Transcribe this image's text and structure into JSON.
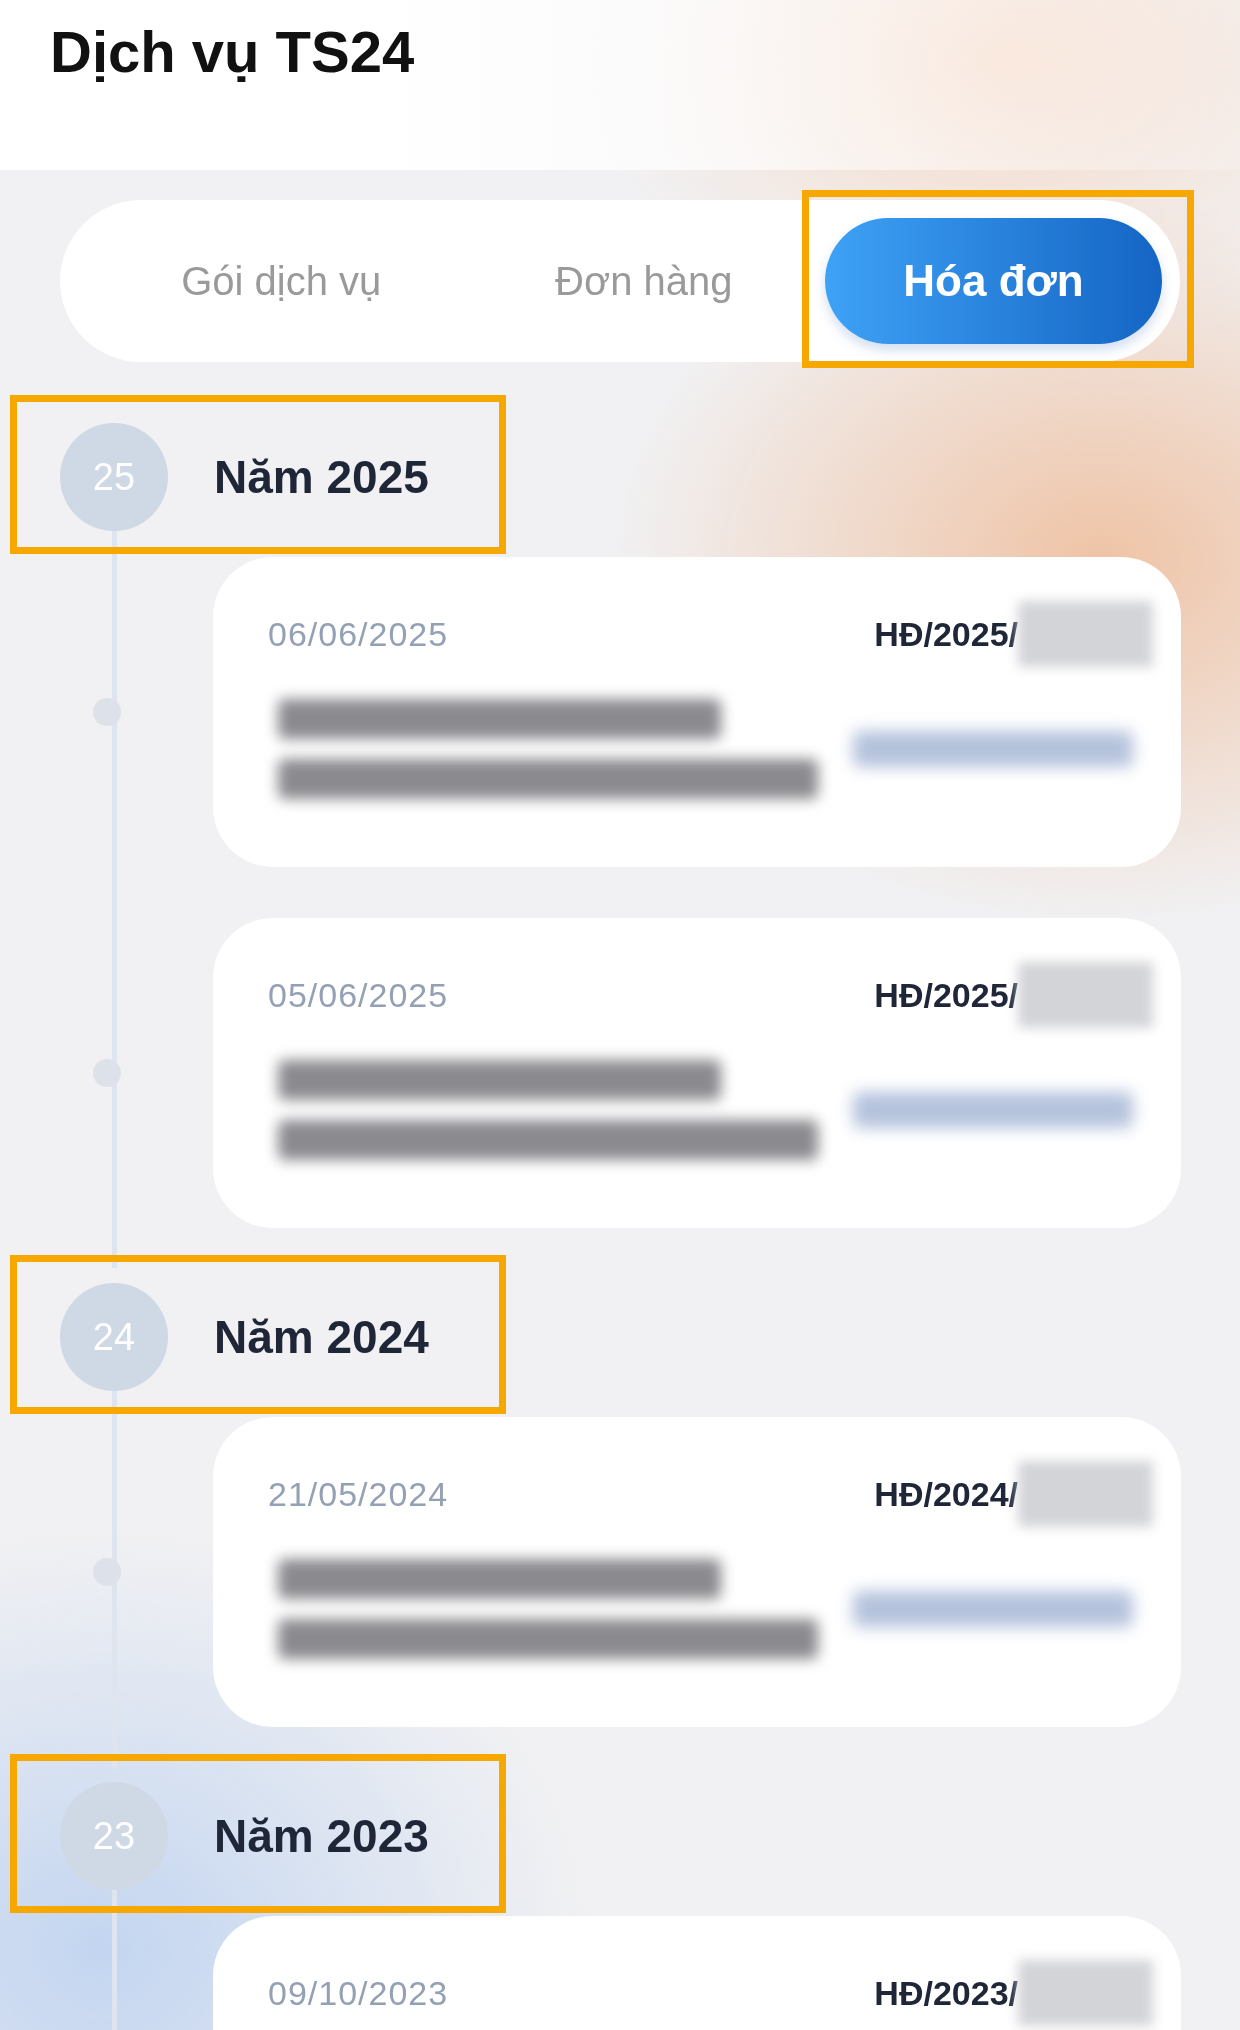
{
  "header": {
    "title": "Dịch vụ TS24"
  },
  "tabs": [
    {
      "label": "Gói dịch vụ",
      "selected": false,
      "highlighted": false
    },
    {
      "label": "Đơn hàng",
      "selected": false,
      "highlighted": false
    },
    {
      "label": "Hóa đơn",
      "selected": true,
      "highlighted": true
    }
  ],
  "years": [
    {
      "badge": "25",
      "label": "Năm 2025",
      "highlighted": true,
      "invoices": [
        {
          "date": "06/06/2025",
          "number": "HĐ/2025/"
        },
        {
          "date": "05/06/2025",
          "number": "HĐ/2025/"
        }
      ]
    },
    {
      "badge": "24",
      "label": "Năm 2024",
      "highlighted": true,
      "invoices": [
        {
          "date": "21/05/2024",
          "number": "HĐ/2024/"
        }
      ]
    },
    {
      "badge": "23",
      "label": "Năm 2023",
      "highlighted": true,
      "invoices": [
        {
          "date": "09/10/2023",
          "number": "HĐ/2023/"
        }
      ]
    }
  ]
}
